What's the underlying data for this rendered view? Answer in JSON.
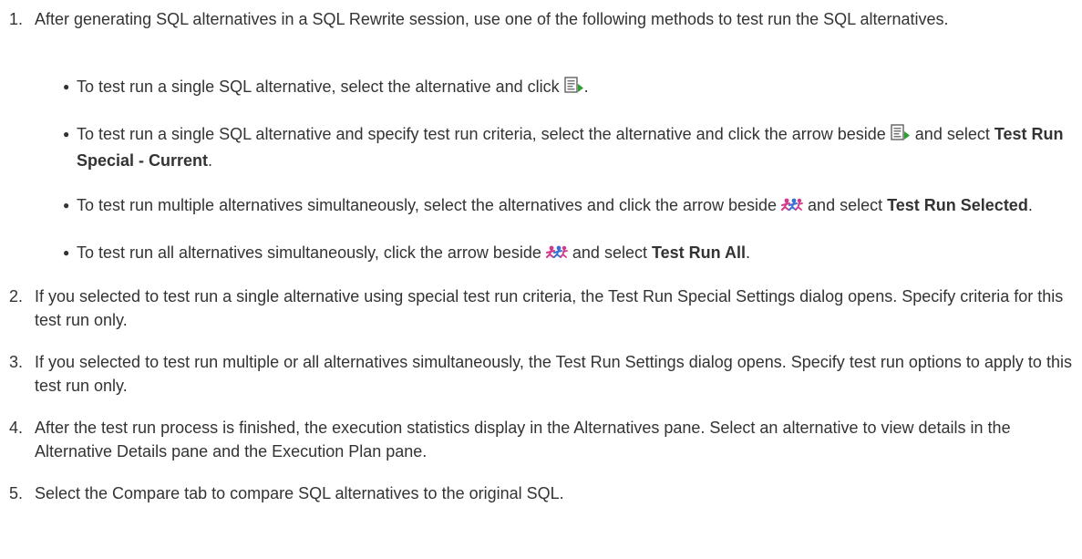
{
  "steps": [
    {
      "num": "1.",
      "text": "After generating SQL alternatives in a SQL Rewrite session, use one of the following methods to test run the SQL alternatives."
    },
    {
      "num": "2.",
      "text": "If you selected to test run a single alternative using special test run criteria, the Test Run Special Settings dialog opens. Specify criteria for this test run only."
    },
    {
      "num": "3.",
      "text": "If you selected to test run multiple or all alternatives simultaneously, the Test Run Settings dialog opens. Specify test run options to apply to this test run only."
    },
    {
      "num": "4.",
      "text": "After the test run process is finished, the execution statistics display in the Alternatives pane. Select an alternative to view details in the Alternative Details pane and the Execution Plan pane."
    },
    {
      "num": "5.",
      "text": "Select the Compare tab to compare SQL alternatives to the original SQL."
    }
  ],
  "bullets": [
    {
      "before": "To test run a single SQL alternative, select the alternative and click ",
      "icon": "test-run-current-icon",
      "after": "."
    },
    {
      "before": "To test run a single SQL alternative and specify test run criteria, select the alternative and click the arrow beside ",
      "icon": "test-run-current-icon",
      "middle": " and select ",
      "bold": "Test Run Special - Current",
      "after": "."
    },
    {
      "before": "To test run multiple alternatives simultaneously, select the alternatives and click the arrow beside ",
      "icon": "test-run-multiple-icon",
      "middle": " and select ",
      "bold": "Test Run Selected",
      "after": "."
    },
    {
      "before": "To test run all alternatives simultaneously, click the arrow beside ",
      "icon": "test-run-multiple-icon",
      "middle": " and select ",
      "bold": "Test Run All",
      "after": "."
    }
  ],
  "colors": {
    "text": "#333333",
    "icon_green": "#2e9e2e",
    "icon_magenta": "#d4388a",
    "icon_blue": "#3a6fd6"
  }
}
